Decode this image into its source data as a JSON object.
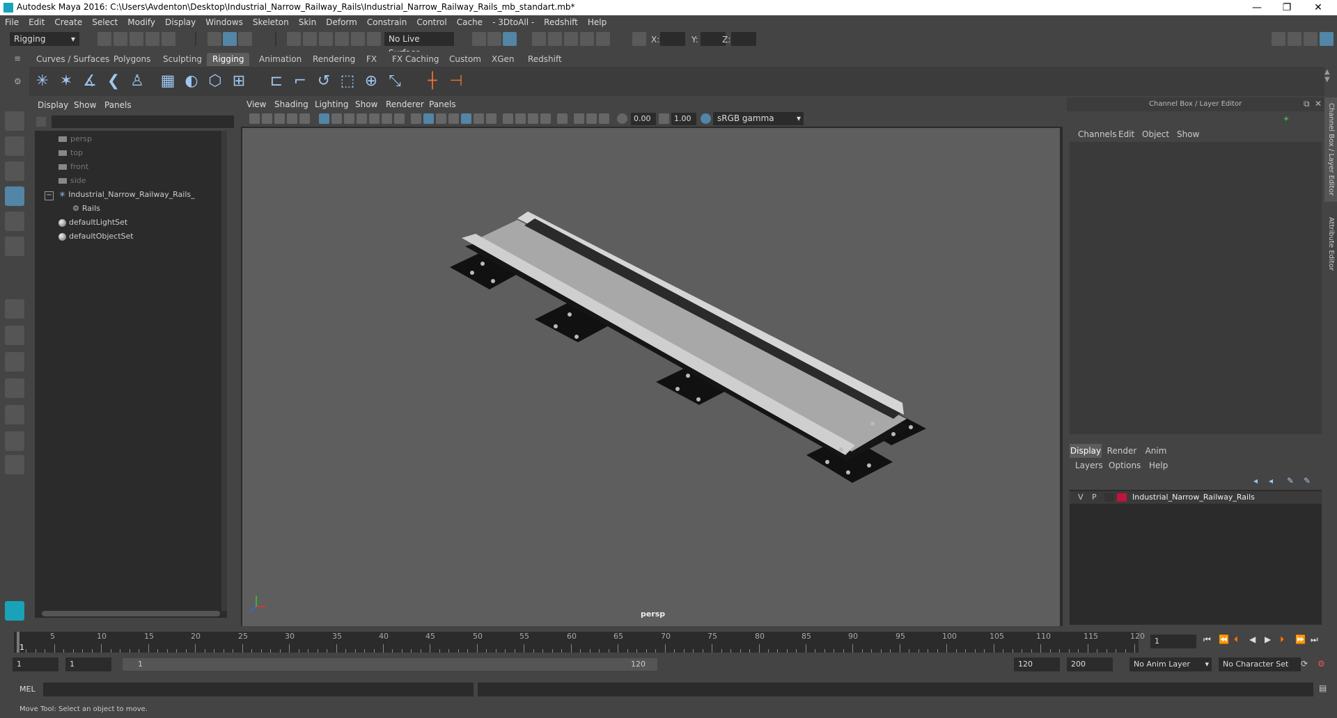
{
  "window": {
    "title": "Autodesk Maya 2016: C:\\Users\\Avdenton\\Desktop\\Industrial_Narrow_Railway_Rails\\Industrial_Narrow_Railway_Rails_mb_standart.mb*",
    "minimize": "—",
    "restore": "❐",
    "close": "✕"
  },
  "menubar": [
    "File",
    "Edit",
    "Create",
    "Select",
    "Modify",
    "Display",
    "Windows",
    "Skeleton",
    "Skin",
    "Deform",
    "Constrain",
    "Control",
    "Cache",
    "- 3DtoAll -",
    "Redshift",
    "Help"
  ],
  "statusline": {
    "mode": "Rigging",
    "live_surface": "No Live Surface",
    "x_label": "X:",
    "y_label": "Y:",
    "z_label": "Z:"
  },
  "shelf_tabs": [
    {
      "label": "Curves / Surfaces",
      "active": false
    },
    {
      "label": "Polygons",
      "active": false
    },
    {
      "label": "Sculpting",
      "active": false
    },
    {
      "label": "Rigging",
      "active": true
    },
    {
      "label": "Animation",
      "active": false
    },
    {
      "label": "Rendering",
      "active": false
    },
    {
      "label": "FX",
      "active": false
    },
    {
      "label": "FX Caching",
      "active": false
    },
    {
      "label": "Custom",
      "active": false
    },
    {
      "label": "XGen",
      "active": false
    },
    {
      "label": "Redshift",
      "active": false
    }
  ],
  "outliner": {
    "menu": [
      "Display",
      "Show",
      "Panels"
    ],
    "items": [
      {
        "label": "persp",
        "dim": true,
        "kind": "camera"
      },
      {
        "label": "top",
        "dim": true,
        "kind": "camera"
      },
      {
        "label": "front",
        "dim": true,
        "kind": "camera"
      },
      {
        "label": "side",
        "dim": true,
        "kind": "camera"
      },
      {
        "label": "Industrial_Narrow_Railway_Rails_",
        "dim": false,
        "kind": "group"
      },
      {
        "label": "Rails",
        "dim": false,
        "kind": "mesh"
      },
      {
        "label": "defaultLightSet",
        "dim": false,
        "kind": "set"
      },
      {
        "label": "defaultObjectSet",
        "dim": false,
        "kind": "set"
      }
    ],
    "expand_symbol": "−"
  },
  "viewport": {
    "menu": [
      "View",
      "Shading",
      "Lighting",
      "Show",
      "Renderer",
      "Panels"
    ],
    "near_value": "0.00",
    "far_value": "1.00",
    "color_space": "sRGB gamma",
    "camera_label": "persp"
  },
  "channel_box": {
    "header": "Channel Box / Layer Editor",
    "menu": [
      "Channels",
      "Edit",
      "Object",
      "Show"
    ],
    "layer_tabs": [
      {
        "label": "Display",
        "active": true
      },
      {
        "label": "Render",
        "active": false
      },
      {
        "label": "Anim",
        "active": false
      }
    ],
    "layer_menu": [
      "Layers",
      "Options",
      "Help"
    ],
    "layer": {
      "v": "V",
      "p": "P",
      "name": "Industrial_Narrow_Railway_Rails",
      "color": "#c0143c"
    },
    "side_tab_1": "Channel Box / Layer Editor",
    "side_tab_2": "Attribute Editor"
  },
  "timeline": {
    "ticks": [
      5,
      10,
      15,
      20,
      25,
      30,
      35,
      40,
      45,
      50,
      55,
      60,
      65,
      70,
      75,
      80,
      85,
      90,
      95,
      100,
      105,
      110,
      115,
      120
    ],
    "min": 1,
    "max": 120,
    "current_frame_marker": "1",
    "current_frame": "1"
  },
  "range": {
    "start": "1",
    "start2": "1",
    "slider_start": "1",
    "slider_end": "120",
    "end": "120",
    "end2": "200",
    "anim_layer": "No Anim Layer",
    "char_set": "No Character Set"
  },
  "cmdline": {
    "label": "MEL"
  },
  "helpline": {
    "text": "Move Tool: Select an object to move."
  },
  "colors": {
    "accent": "#5285a6",
    "bg": "#444444",
    "field": "#2b2b2b",
    "viewport_bg": "#5e5e5e"
  }
}
